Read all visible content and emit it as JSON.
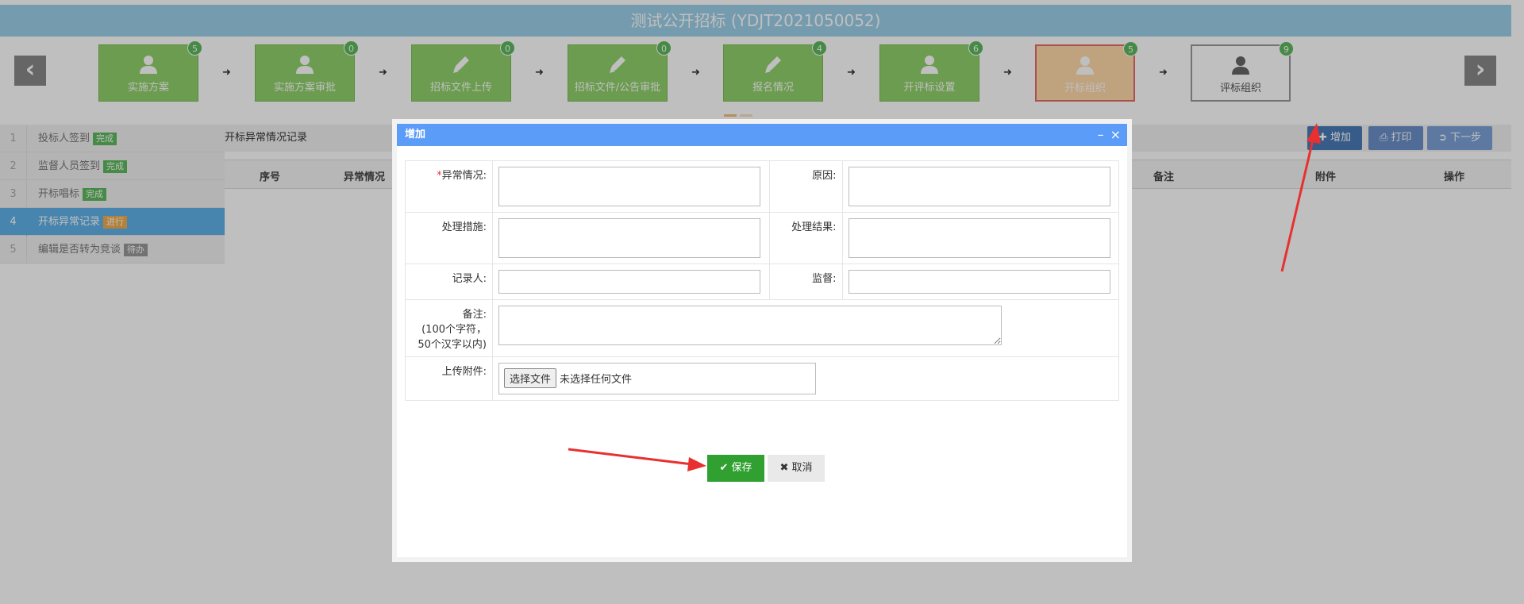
{
  "page": {
    "title": "测试公开招标 (YDJT2021050052)",
    "prev_glyph": "‹",
    "next_glyph": "›"
  },
  "steps": [
    {
      "label": "实施方案",
      "count": "5",
      "icon": "user-icon",
      "state": "done"
    },
    {
      "label": "实施方案审批",
      "count": "0",
      "icon": "user-icon",
      "state": "done"
    },
    {
      "label": "招标文件上传",
      "count": "0",
      "icon": "pencil-icon",
      "state": "done"
    },
    {
      "label": "招标文件/公告审批",
      "count": "0",
      "icon": "pencil-icon",
      "state": "done"
    },
    {
      "label": "报名情况",
      "count": "4",
      "icon": "pencil-icon",
      "state": "done"
    },
    {
      "label": "开评标设置",
      "count": "6",
      "icon": "user-icon",
      "state": "done"
    },
    {
      "label": "开标组织",
      "count": "5",
      "icon": "user-icon",
      "state": "current"
    },
    {
      "label": "评标组织",
      "count": "9",
      "icon": "user-icon",
      "state": "future"
    }
  ],
  "sidebar": {
    "items": [
      {
        "num": "1",
        "label": "投标人签到",
        "status": "完成"
      },
      {
        "num": "2",
        "label": "监督人员签到",
        "status": "完成"
      },
      {
        "num": "3",
        "label": "开标唱标",
        "status": "完成"
      },
      {
        "num": "4",
        "label": "开标异常记录",
        "status": "进行"
      },
      {
        "num": "5",
        "label": "编辑是否转为竞谈",
        "status": "待办"
      }
    ]
  },
  "content": {
    "section_title": "开标异常情况记录",
    "add_label": "增加",
    "print_label": "打印",
    "next_label": "下一步",
    "columns": [
      "序号",
      "异常情况",
      "备注",
      "附件",
      "操作"
    ]
  },
  "modal": {
    "title": "增加",
    "minimize_glyph": "–",
    "close_glyph": "×",
    "required_mark": "*",
    "fields": {
      "abnormal_label": "异常情况:",
      "reason_label": "原因:",
      "measure_label": "处理措施:",
      "result_label": "处理结果:",
      "recorder_label": "记录人:",
      "supervisor_label": "监督:",
      "remark_label": "备注:",
      "remark_hint": "(100个字符，50个汉字以内)",
      "upload_label": "上传附件:",
      "file_button": "选择文件",
      "file_none": "未选择任何文件"
    },
    "save_label": "保存",
    "cancel_label": "取消"
  },
  "colors": {
    "title_bar": "#9ccfe8",
    "step_done": "#8fd06a",
    "step_current": "#ffd8a8",
    "modal_header": "#5a9cf8",
    "save_button": "#30a030",
    "annotation_arrow": "#e83030"
  }
}
